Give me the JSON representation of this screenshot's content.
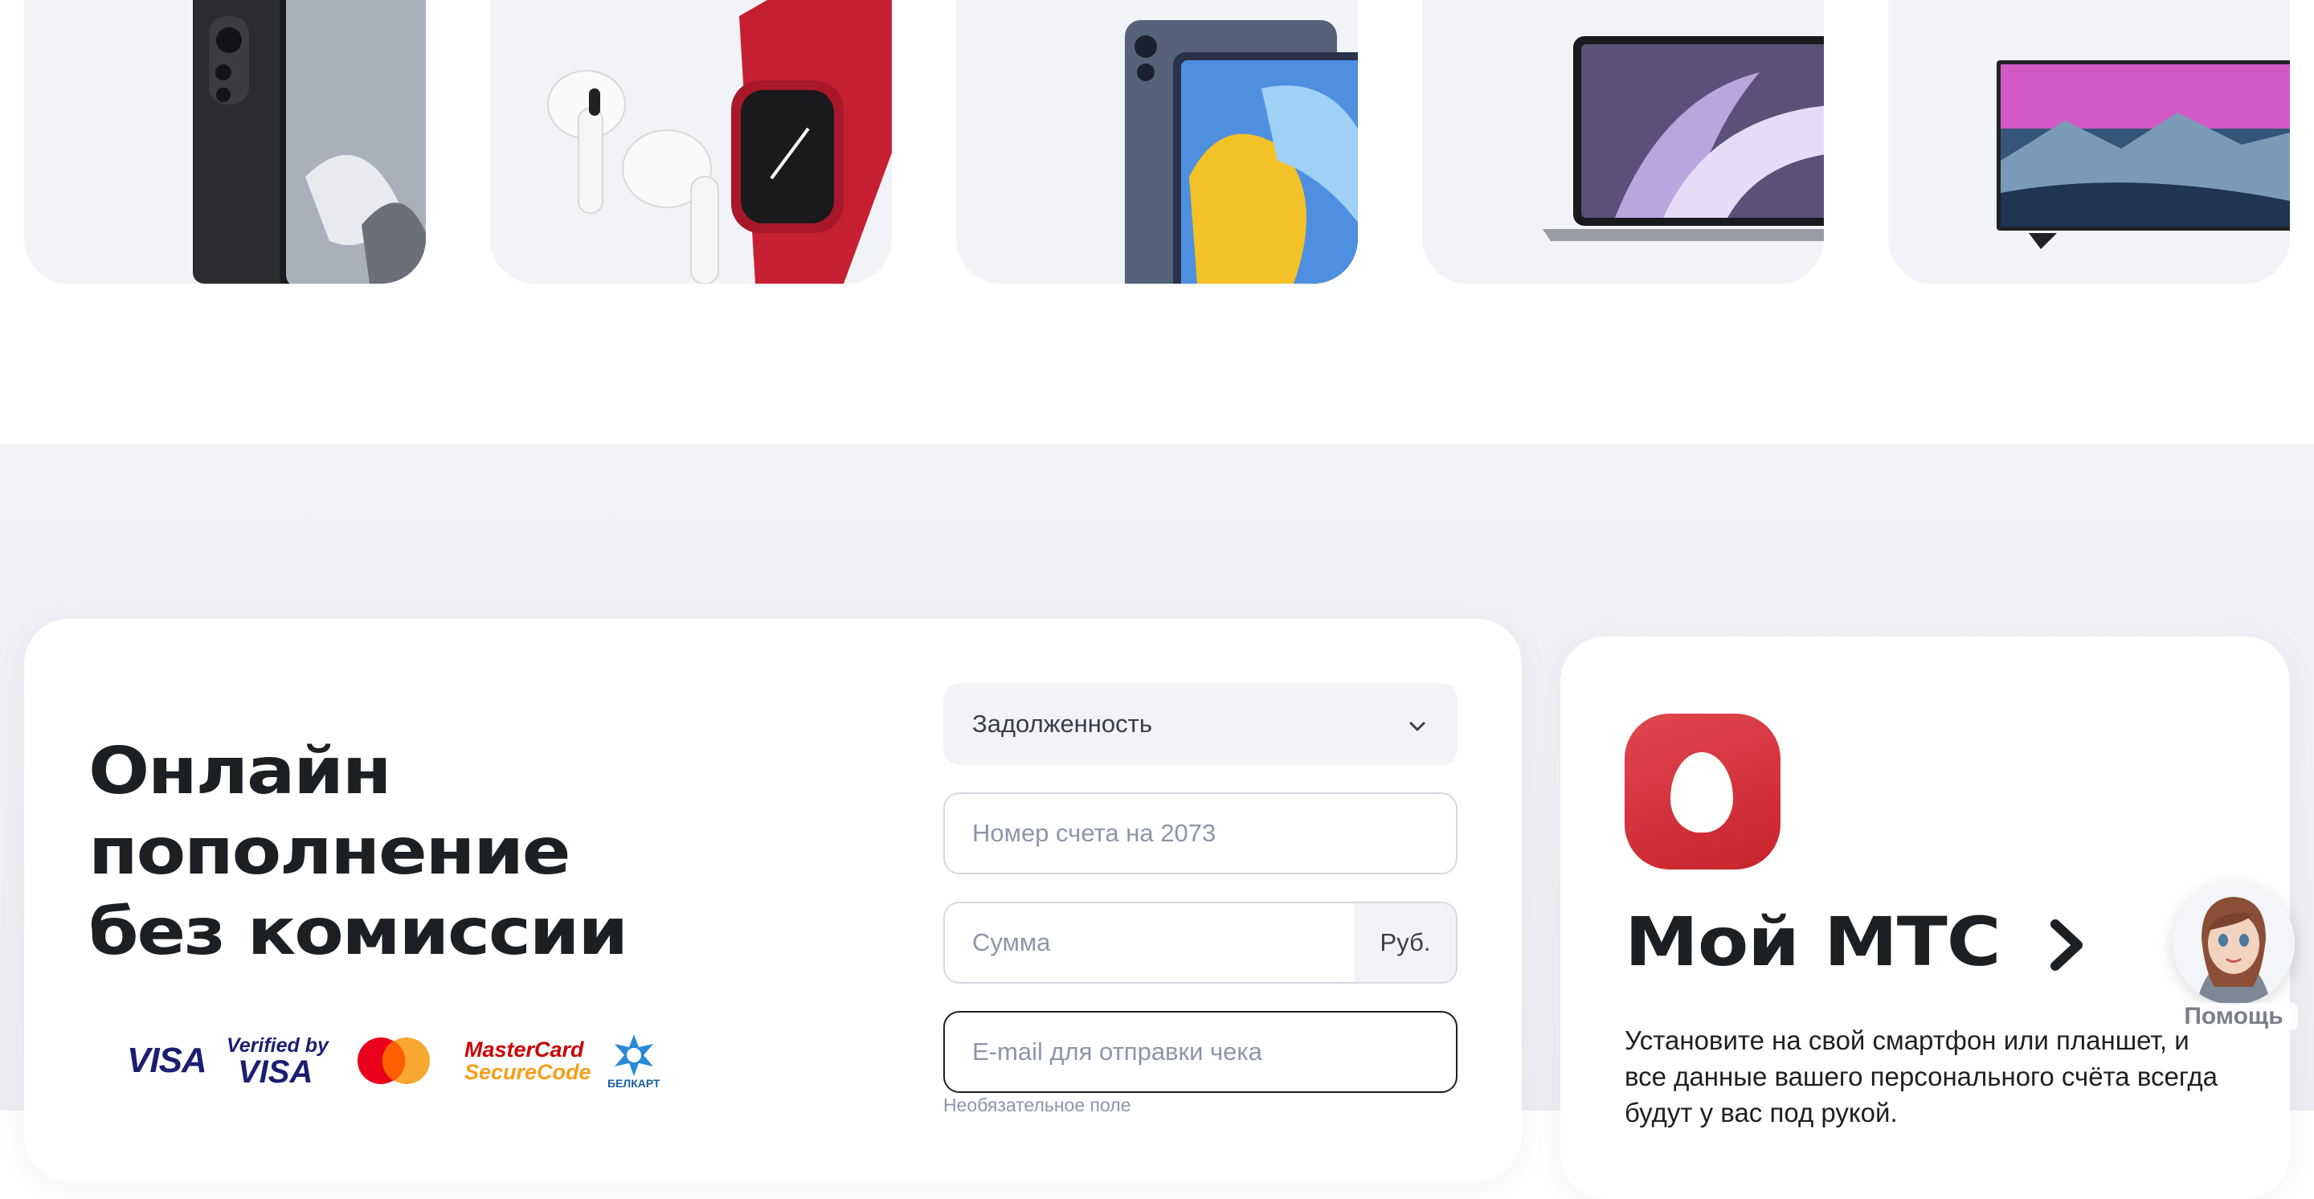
{
  "products": [
    {
      "name": "Смартфон",
      "icon": "smartphone-image"
    },
    {
      "name": "Наушники и часы",
      "icon": "earbuds-watch-image"
    },
    {
      "name": "Планшет",
      "icon": "tablet-image"
    },
    {
      "name": "Ноутбук",
      "icon": "laptop-image"
    },
    {
      "name": "Телевизор",
      "icon": "tv-image"
    }
  ],
  "payment": {
    "title_line1": "Онлайн",
    "title_line2": "пополнение",
    "title_line3": "без комиссии",
    "logos": {
      "visa": "VISA",
      "verified_top": "Verified by",
      "verified_bottom": "VISA",
      "securecode_top": "MasterCard",
      "securecode_bottom": "SecureCode",
      "belcard": "БЕЛКАРТ"
    },
    "type_select": {
      "value": "Задолженность"
    },
    "account_input": {
      "placeholder": "Номер счета на 2073"
    },
    "sum_input": {
      "placeholder": "Сумма",
      "unit": "Руб."
    },
    "email_input": {
      "placeholder": "E-mail для отправки чека",
      "hint": "Необязательное поле"
    }
  },
  "app": {
    "title": "Мой МТС",
    "description": "Установите на свой смартфон или планшет, и все данные вашего персонального счёта всегда будут у вас под рукой."
  },
  "help": {
    "label": "Помощь"
  },
  "colors": {
    "brand": "#e30611",
    "app_icon": "#d3323a",
    "text": "#1d2023",
    "muted": "#8d96a8",
    "surface": "#f2f3f7"
  }
}
